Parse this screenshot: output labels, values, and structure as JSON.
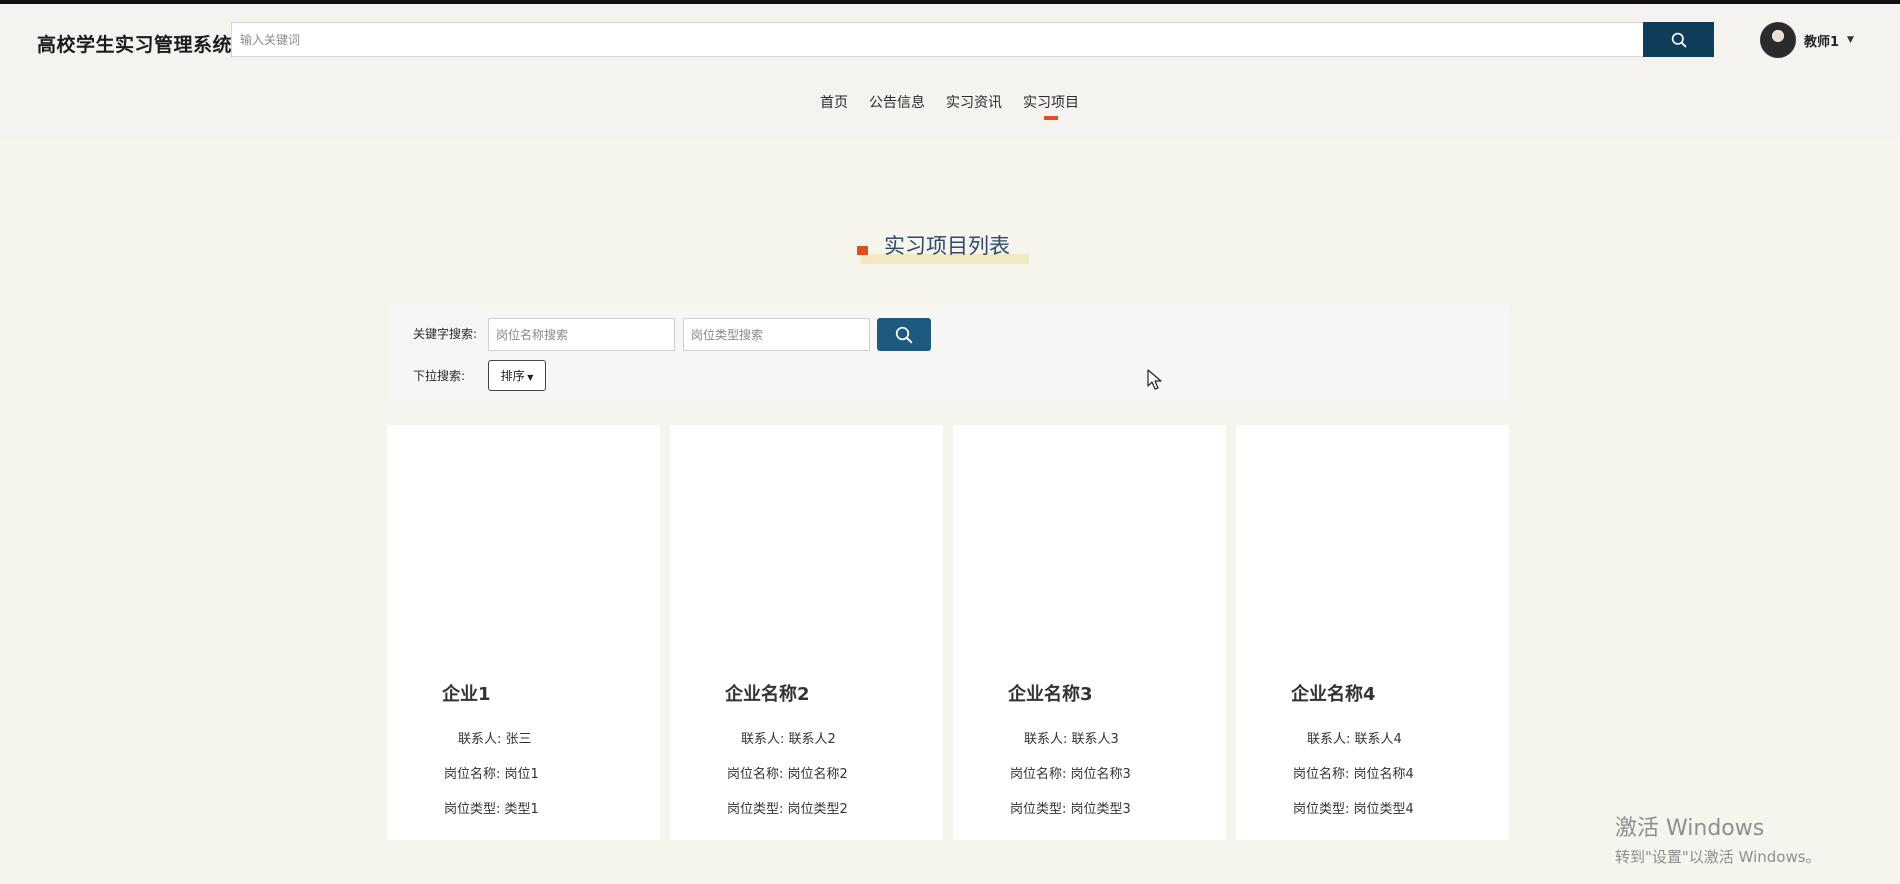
{
  "header": {
    "brand": "高校学生实习管理系统",
    "search_placeholder": "输入关键词",
    "user_name": "教师1"
  },
  "nav": {
    "items": [
      "首页",
      "公告信息",
      "实习资讯",
      "实习项目"
    ],
    "active_index": 3
  },
  "section": {
    "title": "实习项目列表"
  },
  "filters": {
    "keyword_label": "关键字搜索:",
    "position_name_placeholder": "岗位名称搜索",
    "position_type_placeholder": "岗位类型搜索",
    "dropdown_label": "下拉搜索:",
    "sort_label": "排序"
  },
  "cards": [
    {
      "company": "企业1",
      "contact_label": "联系人:",
      "contact": "张三",
      "position_name_label": "岗位名称:",
      "position_name": "岗位1",
      "position_type_label": "岗位类型:",
      "position_type": "类型1"
    },
    {
      "company": "企业名称2",
      "contact_label": "联系人:",
      "contact": "联系人2",
      "position_name_label": "岗位名称:",
      "position_name": "岗位名称2",
      "position_type_label": "岗位类型:",
      "position_type": "岗位类型2"
    },
    {
      "company": "企业名称3",
      "contact_label": "联系人:",
      "contact": "联系人3",
      "position_name_label": "岗位名称:",
      "position_name": "岗位名称3",
      "position_type_label": "岗位类型:",
      "position_type": "岗位类型3"
    },
    {
      "company": "企业名称4",
      "contact_label": "联系人:",
      "contact": "联系人4",
      "position_name_label": "岗位名称:",
      "position_name": "岗位名称4",
      "position_type_label": "岗位类型:",
      "position_type": "岗位类型4"
    }
  ],
  "watermark": {
    "line1": "激活 Windows",
    "line2": "转到\"设置\"以激活 Windows。"
  },
  "colors": {
    "primary": "#0f3d5c",
    "accent": "#e34d1d",
    "title_text": "#2e4a68"
  },
  "icons": {
    "search": "search-icon",
    "caret": "caret-down-icon",
    "cursor": "mouse-pointer-icon"
  }
}
